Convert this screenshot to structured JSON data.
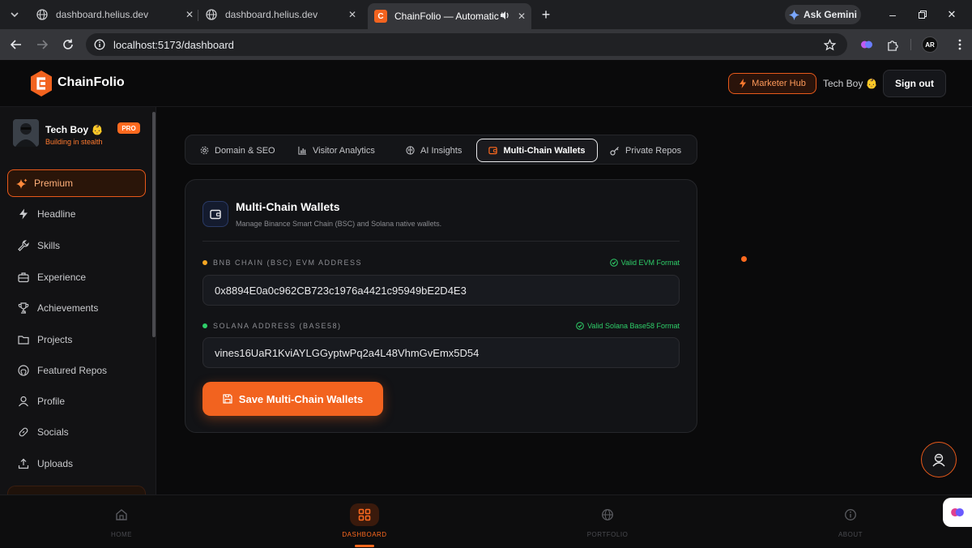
{
  "browser": {
    "tabs": [
      {
        "title": "dashboard.helius.dev"
      },
      {
        "title": "dashboard.helius.dev"
      },
      {
        "title": "ChainFolio — Automatic We"
      }
    ],
    "gemini_label": "Ask Gemini",
    "url": "localhost:5173/dashboard"
  },
  "topnav": {
    "brand": "ChainFolio",
    "marketer_hub": "Marketer Hub",
    "user_name": "Tech Boy 👶",
    "sign_out": "Sign out"
  },
  "sidebar": {
    "user_name": "Tech Boy 👶",
    "user_status": "Building in stealth",
    "badge": "PRO",
    "items": [
      {
        "label": "Premium",
        "icon": "sparkle-icon"
      },
      {
        "label": "Headline",
        "icon": "lightning-icon"
      },
      {
        "label": "Skills",
        "icon": "wrench-icon"
      },
      {
        "label": "Experience",
        "icon": "briefcase-icon"
      },
      {
        "label": "Achievements",
        "icon": "trophy-icon"
      },
      {
        "label": "Projects",
        "icon": "folder-icon"
      },
      {
        "label": "Featured Repos",
        "icon": "github-icon"
      },
      {
        "label": "Profile",
        "icon": "user-icon"
      },
      {
        "label": "Socials",
        "icon": "link-icon"
      },
      {
        "label": "Uploads",
        "icon": "upload-icon"
      }
    ]
  },
  "section_tabs": [
    {
      "label": "Domain & SEO",
      "icon": "gear-icon"
    },
    {
      "label": "Visitor Analytics",
      "icon": "bar-chart-icon"
    },
    {
      "label": "AI Insights",
      "icon": "brain-icon"
    },
    {
      "label": "Multi-Chain Wallets",
      "icon": "wallet-icon"
    },
    {
      "label": "Private Repos",
      "icon": "key-icon"
    }
  ],
  "card": {
    "title": "Multi-Chain Wallets",
    "subtitle": "Manage Binance Smart Chain (BSC) and Solana native wallets.",
    "bsc": {
      "label": "BNB CHAIN (BSC) EVM ADDRESS",
      "status": "Valid EVM Format",
      "value": "0x8894E0a0c962CB723c1976a4421c95949bE2D4E3"
    },
    "solana": {
      "label": "SOLANA ADDRESS (BASE58)",
      "status": "Valid Solana Base58 Format",
      "value": "vines16UaR1KviAYLGGyptwPq2a4L48VhmGvEmx5D54"
    },
    "save_button": "Save Multi-Chain Wallets"
  },
  "bottom_nav": [
    {
      "label": "HOME"
    },
    {
      "label": "DASHBOARD"
    },
    {
      "label": "PORTFOLIO"
    },
    {
      "label": "ABOUT"
    }
  ],
  "colors": {
    "accent": "#f2631f",
    "valid": "#2ecf69",
    "bsc_dot": "#f5a623",
    "sol_dot": "#2ecf69"
  }
}
